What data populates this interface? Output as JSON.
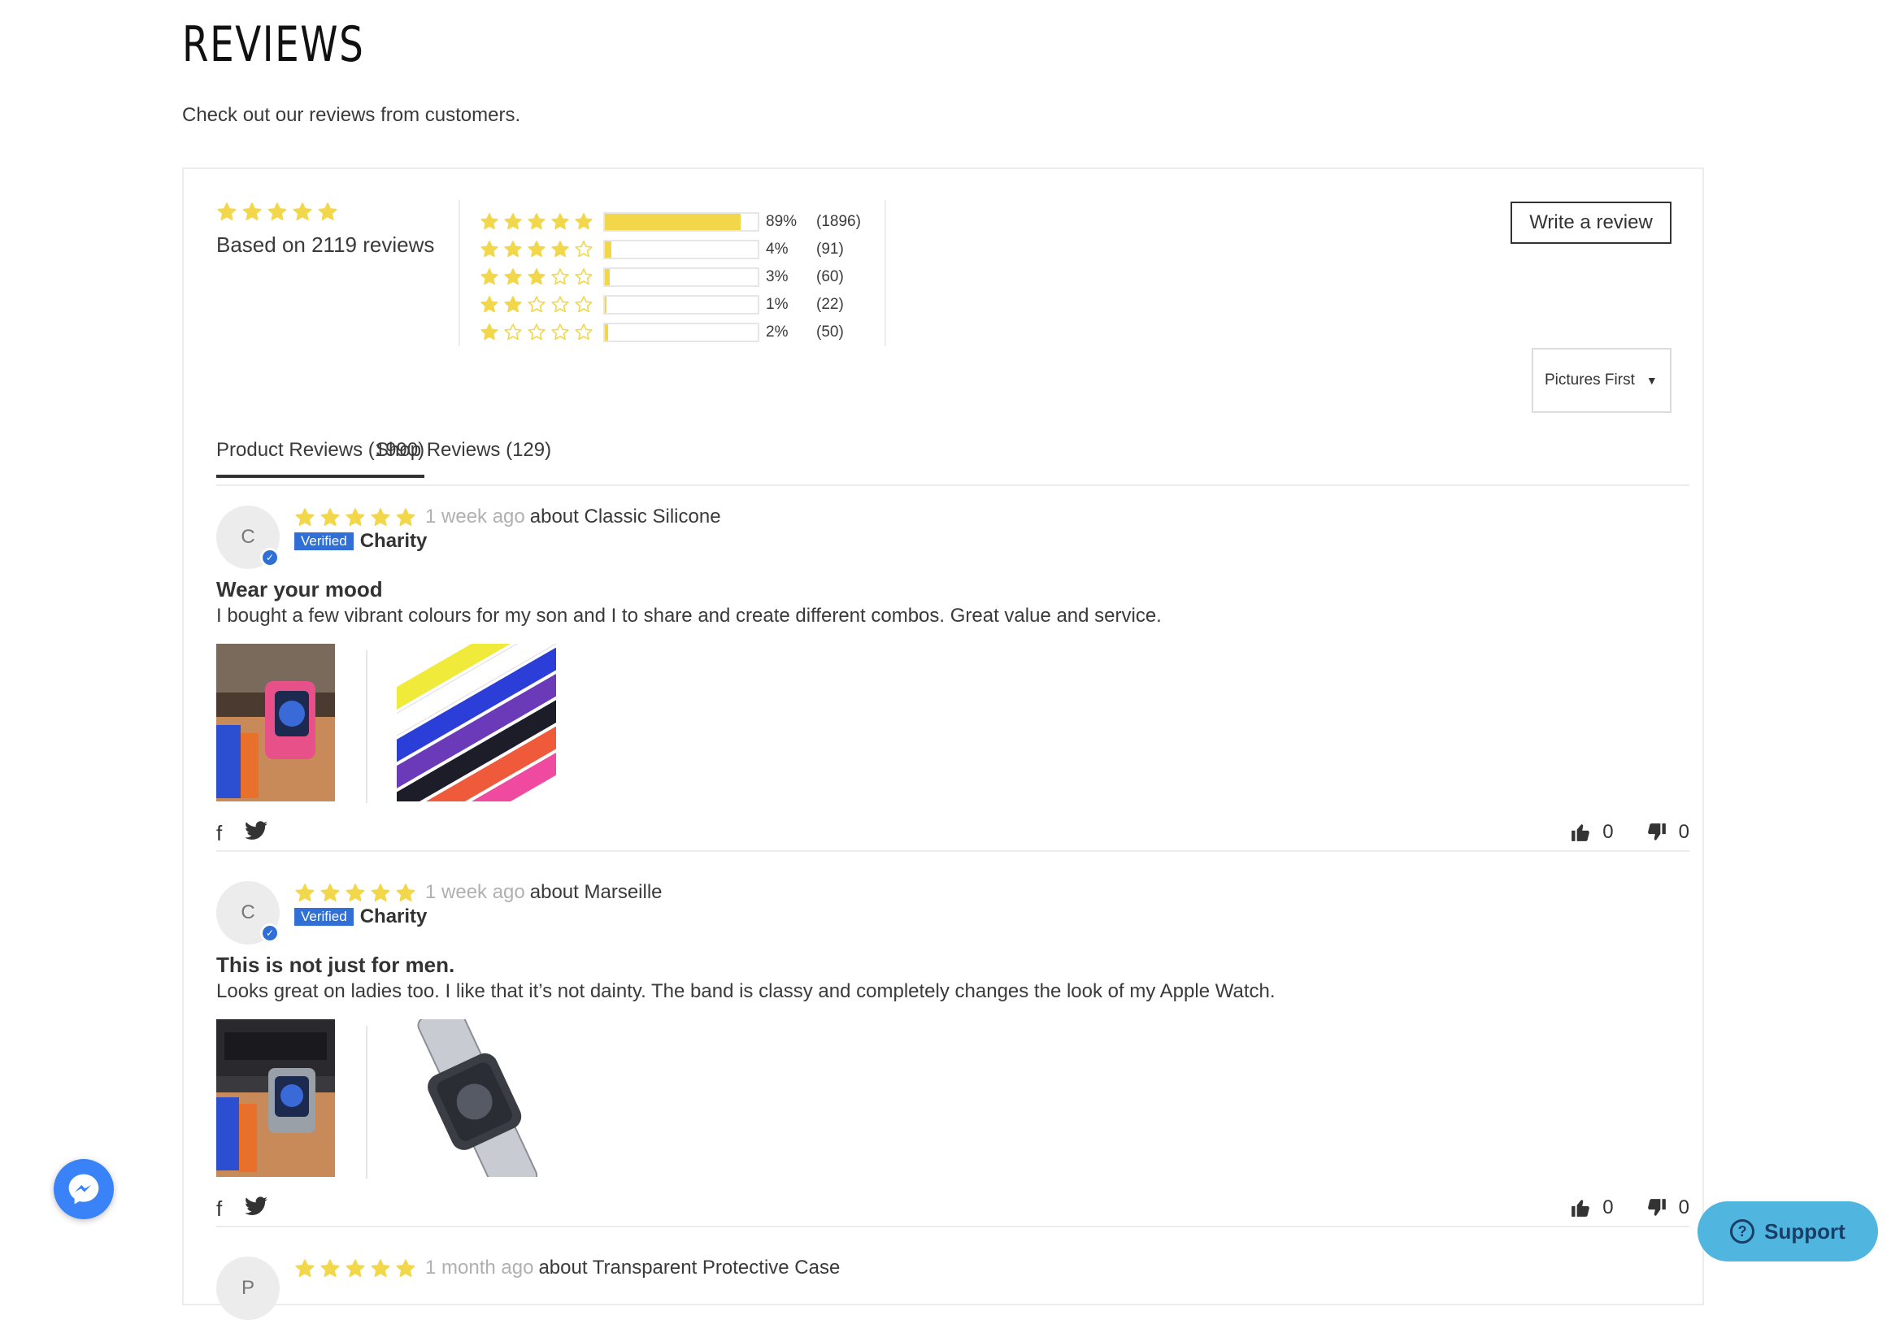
{
  "page": {
    "title": "REVIEWS",
    "subtitle": "Check out our reviews from customers."
  },
  "summary": {
    "average_rating": 5,
    "based_on": "Based on 2119 reviews",
    "histogram": [
      {
        "stars": 5,
        "percent_value": 89,
        "percent": "89%",
        "count": "(1896)"
      },
      {
        "stars": 4,
        "percent_value": 4,
        "percent": "4%",
        "count": "(91)"
      },
      {
        "stars": 3,
        "percent_value": 3,
        "percent": "3%",
        "count": "(60)"
      },
      {
        "stars": 2,
        "percent_value": 1,
        "percent": "1%",
        "count": "(22)"
      },
      {
        "stars": 1,
        "percent_value": 2,
        "percent": "2%",
        "count": "(50)"
      }
    ]
  },
  "actions": {
    "write_review": "Write a review",
    "sort_selected": "Pictures First"
  },
  "tabs": [
    {
      "label": "Product Reviews (1990)",
      "active": true
    },
    {
      "label": "Shop Reviews (129)",
      "active": false
    }
  ],
  "reviews": [
    {
      "initial": "C",
      "rating": 5,
      "ago": "1 week ago",
      "about": "about Classic Silicone",
      "verified_label": "Verified",
      "author": "Charity",
      "title": "Wear your mood",
      "body": "I bought a few vibrant colours for my son and I to share and create different combos. Great value and service.",
      "likes": "0",
      "dislikes": "0"
    },
    {
      "initial": "C",
      "rating": 5,
      "ago": "1 week ago",
      "about": "about Marseille",
      "verified_label": "Verified",
      "author": "Charity",
      "title": "This is not just for men.",
      "body": "Looks great on ladies too. I like that it’s not dainty. The band is classy and completely changes the look of my Apple Watch.",
      "likes": "0",
      "dislikes": "0"
    },
    {
      "initial": "P",
      "rating": 5,
      "ago": "1 month ago",
      "about": "about Transparent Protective Case"
    }
  ],
  "widgets": {
    "support_label": "Support"
  },
  "colors": {
    "star": "#f3d74a",
    "verified": "#2f6fd6",
    "support_bg": "#50b6e0",
    "messenger": "#3a82f7"
  }
}
